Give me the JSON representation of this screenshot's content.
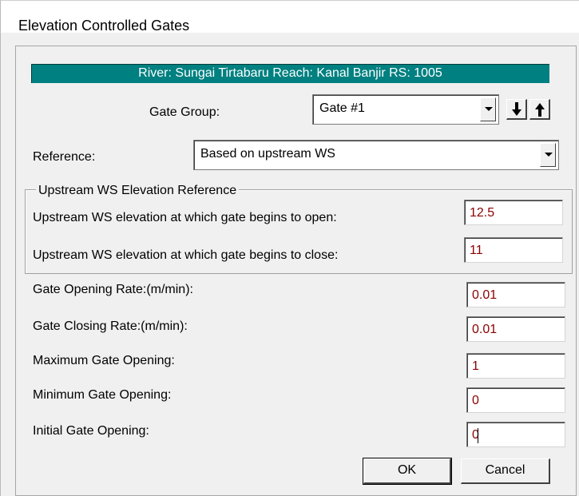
{
  "window": {
    "title": "Elevation Controlled Gates"
  },
  "banner": {
    "text": "River: Sungai Tirtabaru  Reach: Kanal Banjir  RS: 1005"
  },
  "gate_group": {
    "label": "Gate Group:",
    "selected": "Gate #1"
  },
  "reference": {
    "label": "Reference:",
    "selected": "Based on upstream WS"
  },
  "upstream_group": {
    "title": "Upstream WS Elevation Reference",
    "open_label": "Upstream WS elevation at which gate begins to open:",
    "open_value": "12.5",
    "close_label": "Upstream WS elevation at which gate begins to close:",
    "close_value": "11"
  },
  "params": [
    {
      "label": "Gate Opening Rate:(m/min):",
      "value": "0.01"
    },
    {
      "label": "Gate Closing Rate:(m/min):",
      "value": "0.01"
    },
    {
      "label": "Maximum Gate Opening:",
      "value": "1"
    },
    {
      "label": "Minimum Gate Opening:",
      "value": "0"
    },
    {
      "label": "Initial Gate Opening:",
      "value": "0"
    }
  ],
  "buttons": {
    "ok": "OK",
    "cancel": "Cancel"
  },
  "colors": {
    "banner": "#008080",
    "value_text": "#8b0000"
  },
  "icons": {
    "down": "arrow-down-icon",
    "up": "arrow-up-icon",
    "dropdown": "chevron-down-icon"
  }
}
